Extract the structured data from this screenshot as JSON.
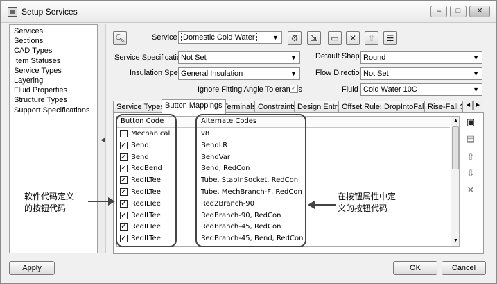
{
  "window": {
    "title": "Setup Services",
    "controls": {
      "minimize": "–",
      "maximize": "□",
      "close": "✕"
    }
  },
  "sidebar": {
    "items": [
      "Services",
      "Sections",
      "CAD Types",
      "Item Statuses",
      "Service Types",
      "Layering",
      "Fluid Properties",
      "Structure Types",
      "Support Specifications"
    ]
  },
  "form": {
    "service_label": "Service",
    "service_value": "Domestic Cold Water",
    "service_spec_label": "Service Specification",
    "service_spec_value": "Not Set",
    "default_shape_label": "Default Shape",
    "default_shape_value": "Round",
    "insulation_spec_label": "Insulation Spec",
    "insulation_spec_value": "General Insulation",
    "flow_direction_label": "Flow Direction",
    "flow_direction_value": "Not Set",
    "ignore_fitting_label": "Ignore Fitting Angle Tolerances",
    "ignore_fitting_checked": true,
    "fluid_label": "Fluid",
    "fluid_value": "Cold Water 10C"
  },
  "tabs": [
    "Service Types",
    "Button Mappings",
    "Terminals",
    "Constraints",
    "Design Entry",
    "Offset Rules",
    "DropIntoFall",
    "Rise-Fall Sy"
  ],
  "active_tab": "Button Mappings",
  "grid": {
    "columns": [
      "Button Code",
      "Alternate Codes"
    ],
    "rows": [
      {
        "code": "Mechanical",
        "alt": "v8",
        "checked": false
      },
      {
        "code": "Bend",
        "alt": "BendLR",
        "checked": true
      },
      {
        "code": "Bend",
        "alt": "BendVar",
        "checked": true
      },
      {
        "code": "RedBend",
        "alt": "Bend, RedCon",
        "checked": true
      },
      {
        "code": "RedILTee",
        "alt": "Tube, StabInSocket, RedCon",
        "checked": true
      },
      {
        "code": "RedILTee",
        "alt": "Tube, MechBranch-F, RedCon",
        "checked": true
      },
      {
        "code": "RedILTee",
        "alt": "Red2Branch-90",
        "checked": true
      },
      {
        "code": "RedILTee",
        "alt": "RedBranch-90, RedCon",
        "checked": true
      },
      {
        "code": "RedILTee",
        "alt": "RedBranch-45, RedCon",
        "checked": true
      },
      {
        "code": "RedILTee",
        "alt": "RedBranch-45, Bend, RedCon",
        "checked": true
      }
    ]
  },
  "annotations": {
    "left_line1": "软件代码定义",
    "left_line2": "的按钮代码",
    "right_line1": "在按钮属性中定",
    "right_line2": "义的按钮代码"
  },
  "footer": {
    "apply": "Apply",
    "ok": "OK",
    "cancel": "Cancel"
  }
}
